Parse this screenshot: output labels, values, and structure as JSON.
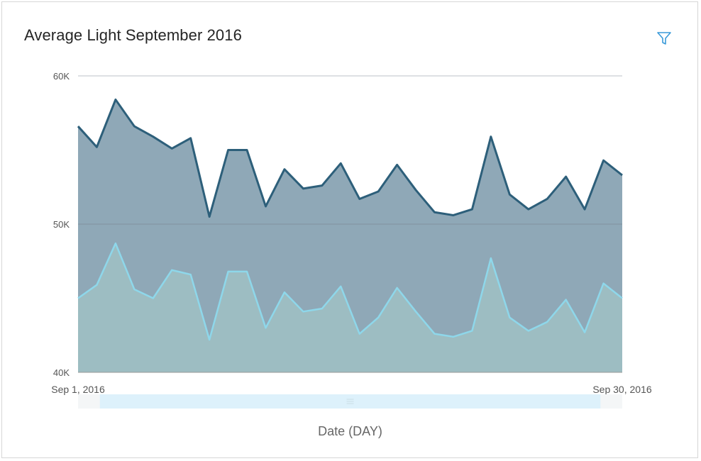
{
  "card": {
    "title": "Average Light September 2016",
    "filter_icon": "filter-icon"
  },
  "chart_data": {
    "type": "area",
    "title": "Average Light September 2016",
    "xlabel": "Date (DAY)",
    "ylabel": "",
    "ylim": [
      40000,
      60000
    ],
    "yticks": [
      40000,
      50000,
      60000
    ],
    "ytick_labels": [
      "40K",
      "50K",
      "60K"
    ],
    "x_tick_labels": [
      "Sep 1, 2016",
      "Sep 30, 2016"
    ],
    "grid": true,
    "stacked": false,
    "x": [
      1,
      2,
      3,
      4,
      5,
      6,
      7,
      8,
      9,
      10,
      11,
      12,
      13,
      14,
      15,
      16,
      17,
      18,
      19,
      20,
      21,
      22,
      23,
      24,
      25,
      26,
      27,
      28,
      29,
      30
    ],
    "series": [
      {
        "color": "#2d5f7a",
        "fill": "#8fa8b7",
        "values": [
          56600,
          55200,
          58400,
          56600,
          55900,
          55100,
          55800,
          50500,
          55000,
          55000,
          51200,
          53700,
          52400,
          52600,
          54100,
          51700,
          52200,
          54000,
          52300,
          50800,
          50600,
          51000,
          55900,
          52000,
          51000,
          51700,
          53200,
          51000,
          54300,
          53300
        ]
      },
      {
        "color": "#8ed7ea",
        "fill": "#9dbdc2",
        "values": [
          45000,
          45900,
          48700,
          45600,
          45000,
          46900,
          46600,
          42200,
          46800,
          46800,
          43000,
          45400,
          44100,
          44300,
          45800,
          42600,
          43700,
          45700,
          44100,
          42600,
          42400,
          42800,
          47700,
          43700,
          42800,
          43400,
          44900,
          42700,
          46000,
          45000
        ]
      }
    ]
  },
  "range_selector": {
    "start_fraction": 0.04,
    "end_fraction": 0.96
  }
}
